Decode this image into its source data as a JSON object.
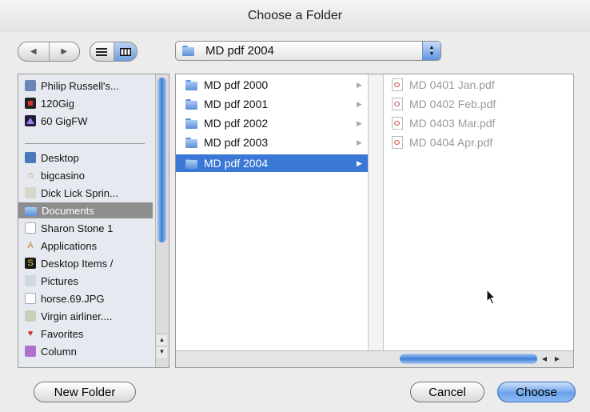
{
  "window": {
    "title": "Choose a Folder"
  },
  "toolbar": {
    "back": "◀",
    "forward": "▶",
    "location": "MD pdf 2004",
    "popup_up": "▲",
    "popup_down": "▼"
  },
  "sidebar": {
    "items": [
      {
        "label": "Philip Russell's...",
        "icon": "computer-icon"
      },
      {
        "label": "120Gig",
        "icon": "drive-icon"
      },
      {
        "label": "60 GigFW",
        "icon": "drive-icon"
      },
      {
        "label": "Desktop",
        "icon": "desktop-icon"
      },
      {
        "label": "bigcasino",
        "icon": "home-icon"
      },
      {
        "label": "Dick Lick Sprin...",
        "icon": "document-icon"
      },
      {
        "label": "Documents",
        "icon": "folder-icon"
      },
      {
        "label": "Sharon Stone 1",
        "icon": "document-icon"
      },
      {
        "label": "Applications",
        "icon": "applications-icon"
      },
      {
        "label": "Desktop Items /",
        "icon": "app-icon"
      },
      {
        "label": "Pictures",
        "icon": "pictures-icon"
      },
      {
        "label": "horse.69.JPG",
        "icon": "document-icon"
      },
      {
        "label": "Virgin airliner....",
        "icon": "document-icon"
      },
      {
        "label": "Favorites",
        "icon": "favorites-icon"
      },
      {
        "label": "Column",
        "icon": "folder-icon"
      }
    ]
  },
  "browser": {
    "folders": [
      {
        "name": "MD pdf 2000",
        "chevron": "▶"
      },
      {
        "name": "MD pdf 2001",
        "chevron": "▶"
      },
      {
        "name": "MD pdf 2002",
        "chevron": "▶"
      },
      {
        "name": "MD pdf 2003",
        "chevron": "▶"
      },
      {
        "name": "MD pdf 2004",
        "chevron": "▶"
      }
    ],
    "files": [
      {
        "name": "MD 0401 Jan.pdf"
      },
      {
        "name": "MD 0402 Feb.pdf"
      },
      {
        "name": "MD 0403 Mar.pdf"
      },
      {
        "name": "MD 0404 Apr.pdf"
      }
    ]
  },
  "buttons": {
    "new_folder": "New Folder",
    "cancel": "Cancel",
    "choose": "Choose"
  },
  "colors": {
    "selection": "#3a78d6",
    "sidebar_selection": "#8d8d8d",
    "accent": "#6aa2ea"
  }
}
